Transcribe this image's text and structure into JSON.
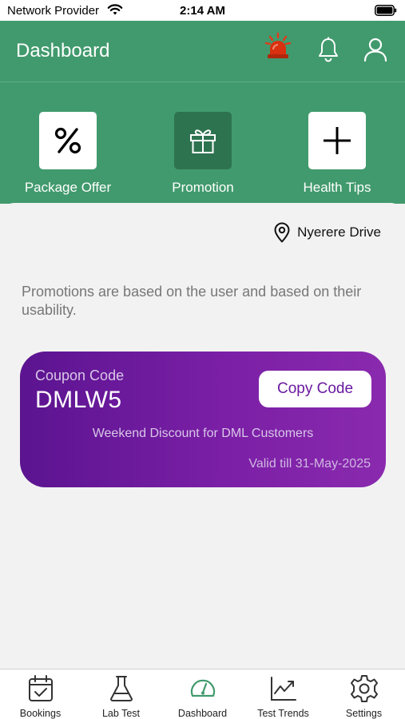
{
  "status_bar": {
    "carrier": "Network Provider",
    "time": "2:14 AM"
  },
  "header": {
    "title": "Dashboard",
    "icons": [
      "siren-icon",
      "bell-icon",
      "user-icon"
    ]
  },
  "quick_actions": [
    {
      "label": "Package Offer",
      "icon": "percent-icon",
      "active": false
    },
    {
      "label": "Promotion",
      "icon": "gift-icon",
      "active": true
    },
    {
      "label": "Health Tips",
      "icon": "plus-icon",
      "active": false
    }
  ],
  "location": {
    "text": "Nyerere Drive",
    "icon": "location-pin-icon"
  },
  "promo_info": "Promotions are based on the user and based on their usability.",
  "coupon": {
    "label": "Coupon Code",
    "code": "DMLW5",
    "copy_button": "Copy Code",
    "description": "Weekend Discount for DML Customers",
    "validity": "Valid till 31-May-2025"
  },
  "tab_bar": [
    {
      "label": "Bookings",
      "icon": "calendar-check-icon"
    },
    {
      "label": "Lab Test",
      "icon": "flask-icon"
    },
    {
      "label": "Dashboard",
      "icon": "gauge-icon",
      "active": true
    },
    {
      "label": "Test Trends",
      "icon": "trend-chart-icon"
    },
    {
      "label": "Settings",
      "icon": "gear-icon"
    }
  ],
  "colors": {
    "brand_green": "#419a6d",
    "active_action": "#2e7350",
    "coupon_start": "#5b1490",
    "coupon_end": "#8a2aae",
    "active_tab": "#419a6d"
  }
}
